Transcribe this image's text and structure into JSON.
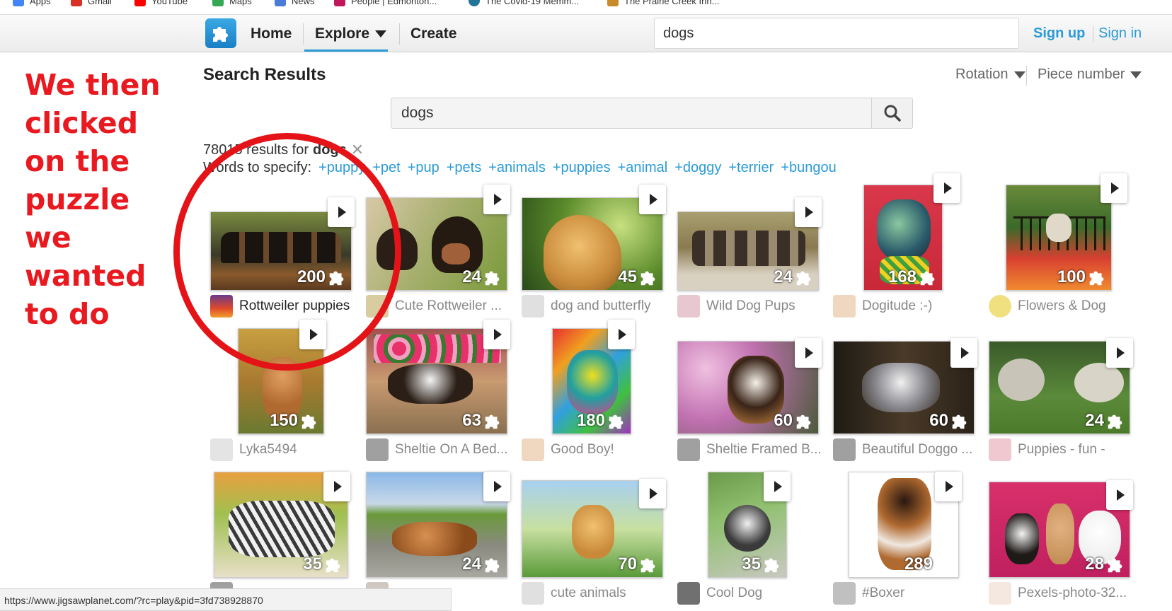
{
  "bookmarks": [
    {
      "label": "Apps",
      "color": "#4285f4"
    },
    {
      "label": "Gmail",
      "color": "#d93025"
    },
    {
      "label": "YouTube",
      "color": "#ff0000"
    },
    {
      "label": "Maps",
      "color": "#34a853"
    },
    {
      "label": "News",
      "color": "#4a7bd8"
    },
    {
      "label": "People | Edmonton...",
      "color": "#c2185b"
    },
    {
      "label": "The Covid-19 Memm...",
      "color": "#21759b"
    },
    {
      "label": "The Prairie Creek Inn...",
      "color": "#c98b2a"
    }
  ],
  "nav": {
    "home": "Home",
    "explore": "Explore",
    "create": "Create",
    "search_value": "dogs",
    "sign_up": "Sign up",
    "sign_in": "Sign in"
  },
  "annotation": {
    "lines": [
      "We then",
      "clicked",
      "on the",
      "puzzle",
      "we",
      "wanted",
      "to do"
    ],
    "color": "#e8191f"
  },
  "results": {
    "title": "Search Results",
    "sort_rotation": "Rotation",
    "sort_pieces": "Piece number",
    "search_value": "dogs",
    "count_text": "78015 results for",
    "query": "dogs",
    "words_label": "Words to specify:",
    "keywords": [
      "+puppy",
      "+pet",
      "+pup",
      "+pets",
      "+animals",
      "+puppies",
      "+animal",
      "+doggy",
      "+terrier",
      "+bungou"
    ]
  },
  "tiles": [
    {
      "pieces": "200",
      "caption": "Rottweiler puppies"
    },
    {
      "pieces": "24",
      "caption": "Cute Rottweiler ..."
    },
    {
      "pieces": "45",
      "caption": "dog and butterfly"
    },
    {
      "pieces": "24",
      "caption": "Wild Dog Pups"
    },
    {
      "pieces": "168",
      "caption": "Dogitude :-)"
    },
    {
      "pieces": "100",
      "caption": "Flowers & Dog"
    },
    {
      "pieces": "150",
      "caption": "Lyka5494"
    },
    {
      "pieces": "63",
      "caption": "Sheltie On A Bed..."
    },
    {
      "pieces": "180",
      "caption": "Good Boy!"
    },
    {
      "pieces": "60",
      "caption": "Sheltie Framed B..."
    },
    {
      "pieces": "60",
      "caption": "Beautiful Doggo ..."
    },
    {
      "pieces": "24",
      "caption": "Puppies - fun -"
    },
    {
      "pieces": "35",
      "caption": ""
    },
    {
      "pieces": "24",
      "caption": ""
    },
    {
      "pieces": "70",
      "caption": "cute animals"
    },
    {
      "pieces": "35",
      "caption": "Cool Dog"
    },
    {
      "pieces": "289",
      "caption": "#Boxer"
    },
    {
      "pieces": "28",
      "caption": "Pexels-photo-32..."
    }
  ],
  "status_url": "https://www.jigsawplanet.com/?rc=play&pid=3fd738928870",
  "colors": {
    "accent": "#2a9bd7",
    "annotation_red": "#e41318"
  }
}
